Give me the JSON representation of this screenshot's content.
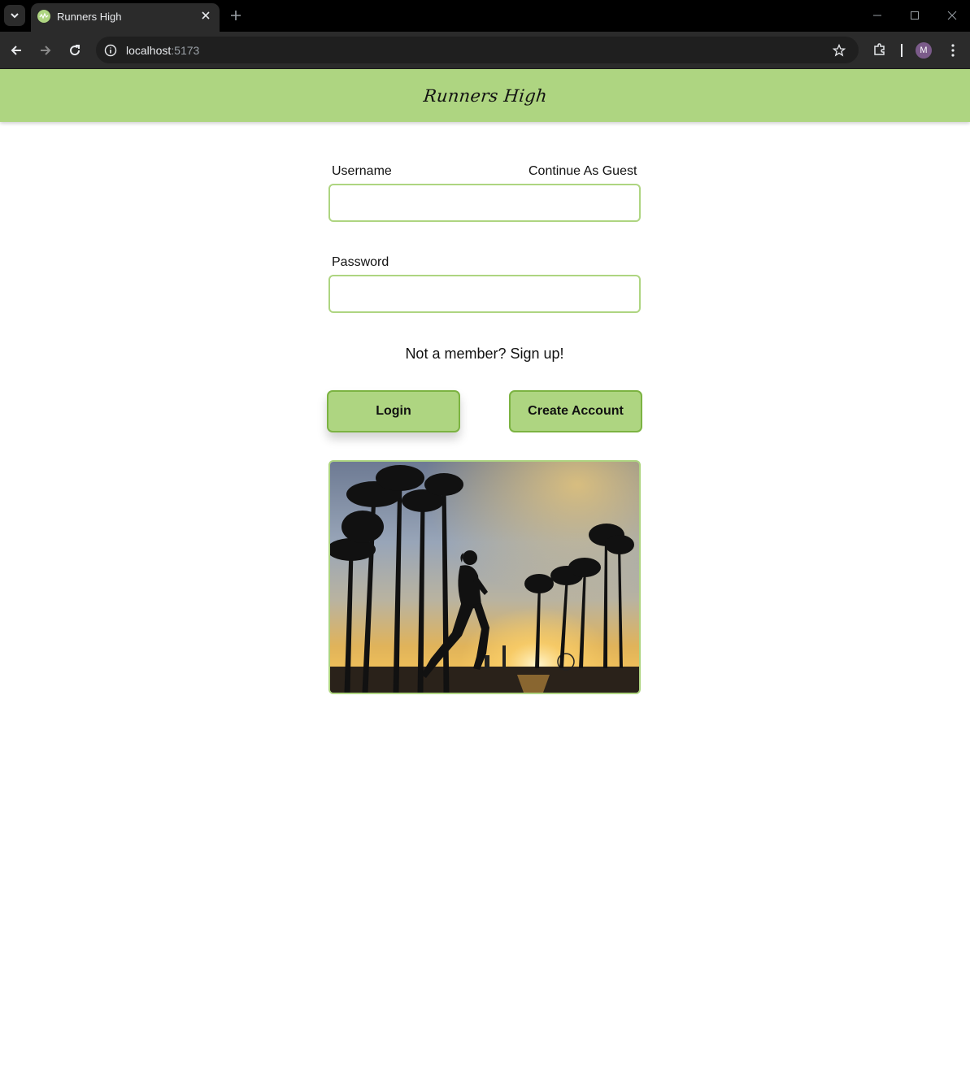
{
  "browser": {
    "tab_title": "Runners High",
    "url_host": "localhost",
    "url_port": ":5173",
    "profile_initial": "M"
  },
  "header": {
    "site_title": "Runners High"
  },
  "login_form": {
    "username_label": "Username",
    "guest_link": "Continue As Guest",
    "username_value": "",
    "password_label": "Password",
    "password_value": "",
    "signup_prompt": "Not a member? Sign up!",
    "login_button": "Login",
    "create_account_button": "Create Account"
  },
  "hero_image": {
    "subject": "runner silhouette with palm trees at sunset"
  },
  "colors": {
    "brand_green": "#aed581",
    "border_green": "#7cb342",
    "chrome_dark": "#2b2b2b"
  }
}
